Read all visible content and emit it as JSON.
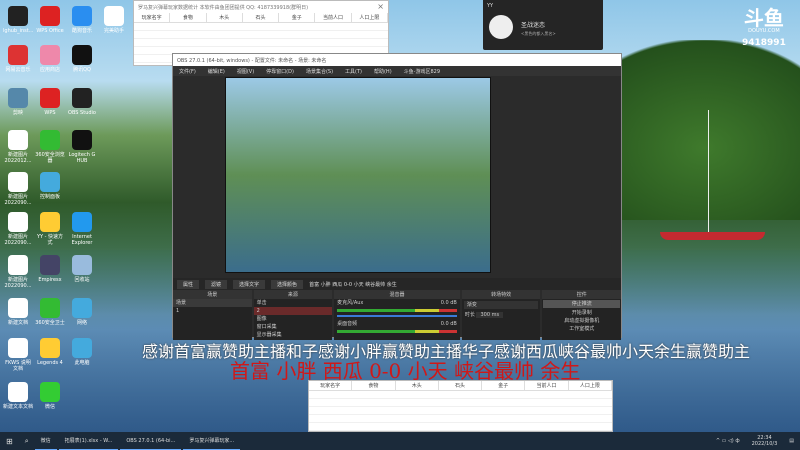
{
  "desktop_icons": [
    {
      "label": "lghub_inst...",
      "color": "#222"
    },
    {
      "label": "WPS Office",
      "color": "#d22"
    },
    {
      "label": "酷狗音乐",
      "color": "#2a8ef0"
    },
    {
      "label": "完美助手",
      "color": "#fff"
    },
    {
      "label": "网易云音乐",
      "color": "#d33"
    },
    {
      "label": "应用商店",
      "color": "#e8a"
    },
    {
      "label": "腾讯QQ",
      "color": "#111"
    },
    {
      "label": "剪映",
      "color": "#58a"
    },
    {
      "label": "WPS",
      "color": "#d22"
    },
    {
      "label": "OBS Studio",
      "color": "#222"
    },
    {
      "label": "新建图片 2022012...",
      "color": "#fff"
    },
    {
      "label": "360安全浏览器",
      "color": "#3b3"
    },
    {
      "label": "Logitech G HUB",
      "color": "#111"
    },
    {
      "label": "新建图片 2022090...",
      "color": "#fff"
    },
    {
      "label": "控制面板",
      "color": "#4ad"
    },
    {
      "label": "新建图片 2022090...",
      "color": "#fff"
    },
    {
      "label": "YY - 快速方式",
      "color": "#fc3"
    },
    {
      "label": "Internet Explorer",
      "color": "#29e"
    },
    {
      "label": "新建图片 2022090...",
      "color": "#fff"
    },
    {
      "label": "Empiresx",
      "color": "#446"
    },
    {
      "label": "回收站",
      "color": "#9bd"
    },
    {
      "label": "新建文档",
      "color": "#fff"
    },
    {
      "label": "360安全卫士",
      "color": "#3b3"
    },
    {
      "label": "网络",
      "color": "#4ad"
    },
    {
      "label": "FKWS 说明 文档",
      "color": "#fff"
    },
    {
      "label": "Legends 4",
      "color": "#fc3"
    },
    {
      "label": "此电脑",
      "color": "#4ad"
    },
    {
      "label": "新建文本文档",
      "color": "#fff"
    },
    {
      "label": "微信",
      "color": "#3c3"
    }
  ],
  "table_window": {
    "title": "罗马复兴弹幕玩家数据统计  本软件由鱼团团提供 QQ: 4187339918(群明日)",
    "columns": [
      "玩家名字",
      "食物",
      "木头",
      "石头",
      "金子",
      "当前人口",
      "人口上限"
    ],
    "close": "×"
  },
  "yy": {
    "app": "YY",
    "name": "圣战迷恋",
    "signature": "<黑色的都入黑名>"
  },
  "douyu": {
    "brand": "DOUYU.COM",
    "room": "9418991"
  },
  "obs": {
    "title": "OBS 27.0.1 (64-bit, windows) - 配置文件: 未命名 - 场景: 未命名",
    "menu": [
      "文件(F)",
      "编辑(E)",
      "视图(V)",
      "停靠窗口(D)",
      "场景集合(S)",
      "工具(T)",
      "帮助(H)",
      "斗鱼-游戏区829"
    ],
    "controls": [
      "属性",
      "滤镜",
      "选择文字",
      "选择颜色"
    ],
    "ticker": "首富 小胖 西瓜 0-0 小天 峡谷最帅 余生",
    "docks": {
      "scenes": {
        "title": "场景",
        "items": [
          "场景",
          "1"
        ]
      },
      "sources": {
        "title": "来源",
        "items": [
          "单击",
          "2",
          "图像",
          "窗口采集",
          "显示器采集"
        ]
      },
      "mixer": {
        "title": "混音器",
        "tracks": [
          {
            "name": "麦克风/Aux",
            "db": "0.0 dB"
          },
          {
            "name": "桌面音频",
            "db": "0.0 dB"
          }
        ]
      },
      "transitions": {
        "title": "转场特效",
        "type": "渐变",
        "duration_label": "时长",
        "duration": "300 ms"
      },
      "controls": {
        "title": "控件",
        "buttons": [
          "停止推流",
          "开始录制",
          "启动虚拟摄像机",
          "工作室模式"
        ]
      }
    }
  },
  "danmaku": "感谢首富赢赞助主播和子感谢小胖赢赞助主播华子感谢西瓜峡谷最帅小天余生赢赞助主",
  "ranking": "首富 小胖 西瓜 0-0 小天 峡谷最帅 余生",
  "bottom_table": {
    "columns": [
      "玩家名字",
      "食物",
      "木头",
      "石头",
      "金子",
      "当前人口",
      "人口上限"
    ]
  },
  "taskbar": {
    "apps": [
      "微信",
      "拓展表(1).xlsx - W...",
      "OBS 27.0.1 (64-bi...",
      "罗马复兴弹幕玩家..."
    ],
    "time": "22:34",
    "date": "2022/10/3"
  }
}
